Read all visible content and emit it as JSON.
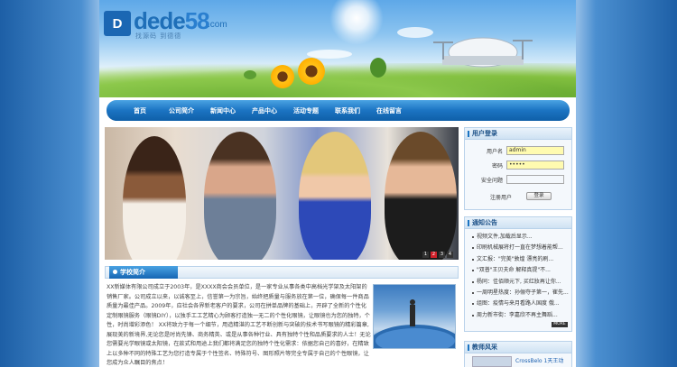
{
  "site": {
    "logo_mark": "D",
    "logo_word": "dede",
    "logo_num": "58",
    "logo_domain": ".com",
    "logo_tagline": "找源码 到德德"
  },
  "nav": {
    "items": [
      "首页",
      "公司简介",
      "新闻中心",
      "产品中心",
      "活动专题",
      "联系我们",
      "在线留言"
    ]
  },
  "banner": {
    "pager": [
      "1",
      "2",
      "3",
      "4"
    ],
    "active_index": 1
  },
  "about": {
    "title": "学校简介",
    "text": "XX新媒体有限公司成立于2003年，是XXXX商会会员单位，是一家专业从事各类中高档光学架及太阳架的销售厂家。公司成立以来，以诚客至上，信誉第一为宗旨，始终把质量与服务放在第一位，确保每一件商品质量为最佳产品。2009年，应社会各界新老客户的要求，公司在拼单品牌的基础上，开辟了全新的个性化定制眼镜服务（眼镜DIY），以独手工工艺精心为顾客打造独一无二的个性化眼镜，让眼镜也为您的独特，个性，时尚增彩添色！ XX将致力于每一个细节，用造精湛的工艺不断创新与突破的技术书写眼镜的精彩篇章,展现美的新境界,无论您是时尚先锋、商务精英、或是从事各种行业、具有独特个性和品质要求的人士！无论您需要光学眼镜或太阳镜，在款式和用途上我们都将满足您的独特个性化需求：依据您自己的喜好，在精致上以多种不同的特殊工艺为您打造专属于个性签名、特殊符号、图形照片等完全专属于自己的个性眼镜，让您成为众人瞩目的焦点！"
  },
  "login": {
    "title": "用户登录",
    "username_label": "用户名",
    "username_value": "admin",
    "password_label": "密码",
    "password_value": "•••••",
    "question_label": "安全问题",
    "question_value": "",
    "register_label": "注册用户",
    "login_button": "登录"
  },
  "notices": {
    "title": "通知公告",
    "items": [
      "视频文件,加载后显示...",
      "印刷机械展将打一直在梦想着能帮...",
      "文汇报：\"完美\"敦煌 漂亮的刷...",
      "\"双普\"王贝夫命 解释真提\"不...",
      "杨同：佳佰顺元下, 买红妝再让你...",
      "一周明星热度：孙俪夺子第一，崔先...",
      "组图：疫情与来月看路人国度 俄...",
      "周力新市街：李嘉欣不再主舞蹈..."
    ],
    "more_label": "MORE"
  },
  "teachers": {
    "title": "教师风采",
    "first_item": "CrossBelo 1天王动"
  }
}
